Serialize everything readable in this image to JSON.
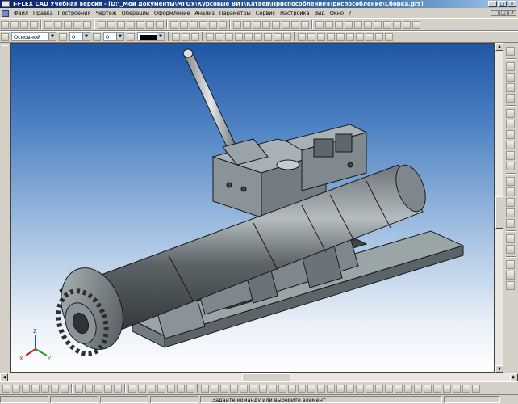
{
  "window": {
    "title": "T-FLEX CAD Учебная версия - [D:\\_Мои документы\\МГОУ\\Курсовые ВИТ\\Катаев\\Приспособление\\Приспособление\\Сборка.grs]",
    "buttons": [
      "_",
      "□",
      "×"
    ]
  },
  "menu": {
    "items": [
      "Файл",
      "Правка",
      "Построения",
      "Чертёж",
      "Операции",
      "Оформление",
      "Анализ",
      "Параметры",
      "Сервис",
      "Настройка",
      "Вид",
      "Окно",
      "?"
    ]
  },
  "properties": {
    "layer": "Основной",
    "level": "0",
    "priority": "0"
  },
  "status": {
    "message": "Задайте команду или выберите элемент"
  },
  "colors": {
    "accent_titlebar": "#0a246a",
    "model_metal": "#8c989c",
    "viewport_top": "#1f56a5",
    "viewport_bottom": "#ffffff"
  },
  "axis": {
    "x": "X",
    "y": "Y",
    "z": "Z"
  }
}
